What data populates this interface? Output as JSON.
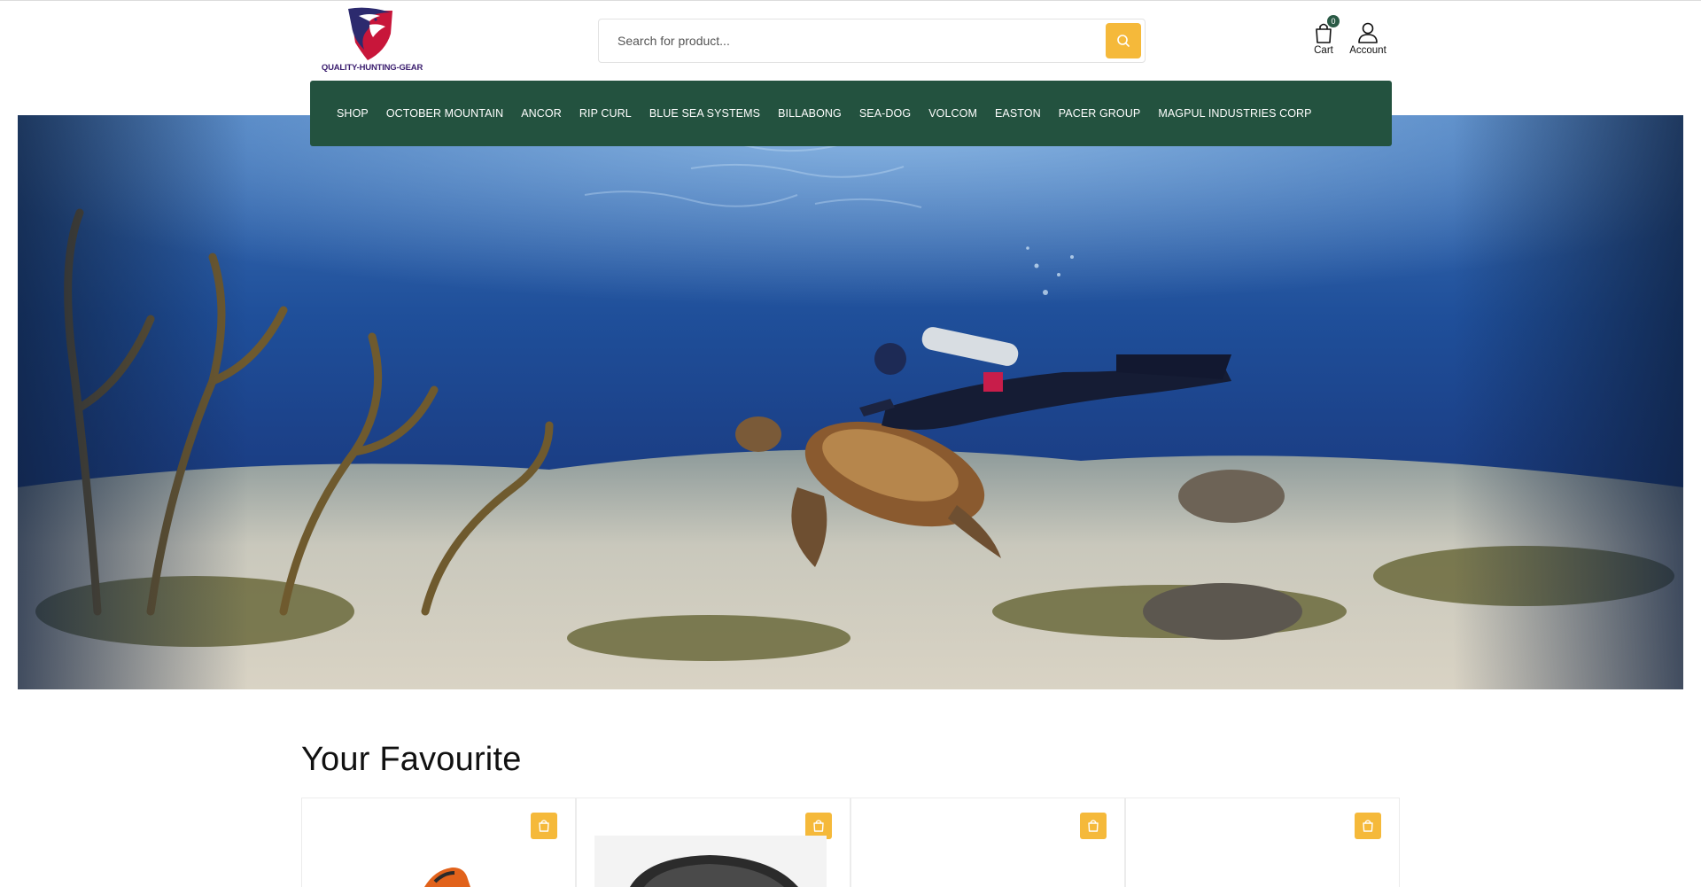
{
  "brand": {
    "logo_text": "QUALITY-HUNTING-GEAR"
  },
  "search": {
    "placeholder": "Search for product..."
  },
  "header": {
    "cart_label": "Cart",
    "cart_count": "0",
    "account_label": "Account"
  },
  "nav": {
    "items": [
      {
        "label": "SHOP"
      },
      {
        "label": "OCTOBER MOUNTAIN"
      },
      {
        "label": "ANCOR"
      },
      {
        "label": "RIP CURL"
      },
      {
        "label": "BLUE SEA SYSTEMS"
      },
      {
        "label": "BILLABONG"
      },
      {
        "label": "SEA-DOG"
      },
      {
        "label": "VOLCOM"
      },
      {
        "label": "EASTON"
      },
      {
        "label": "PACER GROUP"
      },
      {
        "label": "MAGPUL INDUSTRIES CORP"
      }
    ]
  },
  "favourites": {
    "title": "Your Favourite",
    "cards": [
      {
        "add_icon": "shopping-bag-icon"
      },
      {
        "add_icon": "shopping-bag-icon"
      },
      {
        "add_icon": "shopping-bag-icon"
      },
      {
        "add_icon": "shopping-bag-icon"
      }
    ]
  },
  "colors": {
    "nav_background": "#23523f",
    "accent_button": "#f5b93a",
    "badge": "#2a5a45"
  }
}
